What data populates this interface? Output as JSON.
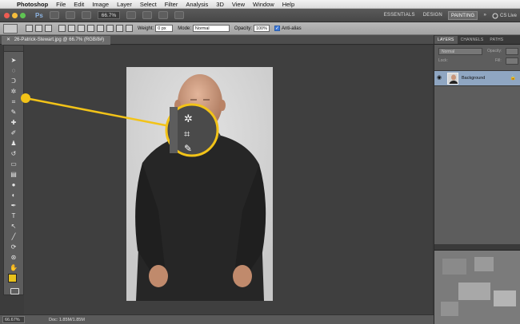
{
  "menubar": {
    "app_name": "Photoshop",
    "items": [
      "File",
      "Edit",
      "Image",
      "Layer",
      "Select",
      "Filter",
      "Analysis",
      "3D",
      "View",
      "Window",
      "Help"
    ]
  },
  "appbar": {
    "logo": "Ps",
    "zoom": "66.7%",
    "workspaces": [
      "ESSENTIALS",
      "DESIGN",
      "PAINTING"
    ],
    "active_workspace": "PAINTING",
    "more": "»",
    "cs_live": "CS Live"
  },
  "optionsbar": {
    "weight_label": "Weight:",
    "weight_value": "0 px",
    "mode_label": "Mode:",
    "mode_value": "Normal",
    "opacity_label": "Opacity:",
    "opacity_value": "100%",
    "antialias_label": "Anti-alias",
    "antialias_checked": true
  },
  "document": {
    "tab_title": "26-Patrick-Stewart.jpg @ 66.7% (RGB/8#)",
    "close_glyph": "✕"
  },
  "statusbar": {
    "zoom": "66.67%",
    "doc_info": "Doc: 1.85M/1.85M"
  },
  "layers_panel": {
    "tabs": [
      "LAYERS",
      "CHANNELS",
      "PATHS"
    ],
    "active_tab": "LAYERS",
    "blend_mode": "Normal",
    "opacity_label": "Opacity:",
    "lock_label": "Lock:",
    "fill_label": "Fill:",
    "layers": [
      {
        "name": "Background",
        "visible": true,
        "locked": true,
        "selected": true
      }
    ]
  },
  "tools": {
    "foreground_color": "#e8c21c",
    "background_color": "#ffffff",
    "icons": [
      "move-tool-icon",
      "marquee-tool-icon",
      "lasso-tool-icon",
      "quick-selection-tool-icon",
      "crop-tool-icon",
      "eyedropper-tool-icon",
      "healing-brush-tool-icon",
      "brush-tool-icon",
      "clone-stamp-tool-icon",
      "history-brush-tool-icon",
      "eraser-tool-icon",
      "gradient-tool-icon",
      "blur-tool-icon",
      "dodge-tool-icon",
      "pen-tool-icon",
      "type-tool-icon",
      "path-selection-tool-icon",
      "shape-tool-icon",
      "3d-rotate-tool-icon",
      "3d-orbit-tool-icon",
      "hand-tool-icon",
      "zoom-tool-icon"
    ]
  },
  "colors": {
    "highlight": "#f2c318",
    "selected_layer": "#8fa6c2"
  }
}
